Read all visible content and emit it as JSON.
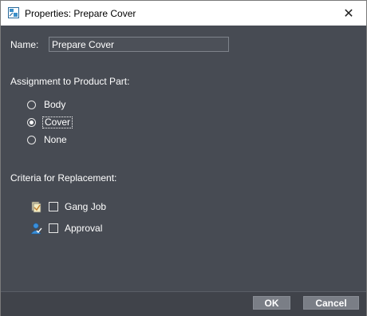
{
  "window": {
    "title": "Properties: Prepare Cover",
    "close_glyph": "✕"
  },
  "form": {
    "name_label": "Name:",
    "name_value": "Prepare Cover",
    "assignment_label": "Assignment to Product Part:",
    "assignment_options": [
      {
        "label": "Body",
        "checked": false
      },
      {
        "label": "Cover",
        "checked": true
      },
      {
        "label": "None",
        "checked": false
      }
    ],
    "criteria_label": "Criteria for Replacement:",
    "criteria_options": [
      {
        "label": "Gang Job",
        "icon": "gang-job-icon",
        "checked": false
      },
      {
        "label": "Approval",
        "icon": "approval-icon",
        "checked": false
      }
    ]
  },
  "footer": {
    "ok_label": "OK",
    "cancel_label": "Cancel"
  },
  "colors": {
    "background": "#474b53",
    "footer": "#40434a",
    "button": "#7a7e86",
    "text": "#ffffff"
  }
}
